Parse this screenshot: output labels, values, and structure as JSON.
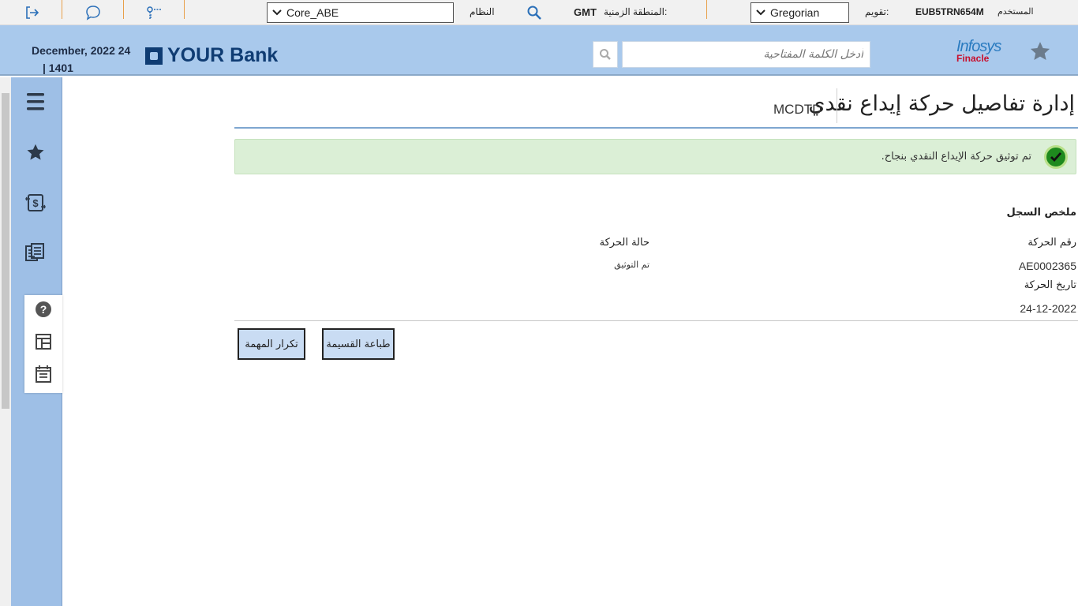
{
  "topbar": {
    "icons": [
      "logout-icon",
      "chat-icon",
      "key-icon"
    ],
    "environment_select": "Core_ABE",
    "system_label": "النظام",
    "timezone_label": "المنطقة الزمنية:",
    "timezone_value": "GMT",
    "calendar_select": "Gregorian",
    "calendar_label": "تقويم:",
    "user_label": "المستخدم",
    "user_id": "EUB5TRN654M"
  },
  "header": {
    "date_primary": "December, 2022 24",
    "date_secondary": "| 1401",
    "bank_name": "YOUR Bank",
    "search_placeholder": "أدخل الكلمة المفتاحية",
    "vendor_logo_line1": "Infosys",
    "vendor_logo_line2": "Finacle"
  },
  "sidebar": {
    "icons": [
      "menu-icon",
      "star-icon",
      "currency-exchange-icon",
      "documents-icon"
    ],
    "panel_icons": [
      "help-icon",
      "layout-icon",
      "calendar-icon"
    ]
  },
  "main": {
    "title": "إدارة تفاصيل حركة إيداع نقدي",
    "function_code": "MCDTD",
    "success_message": "تم توثيق حركة الإيداع النقدي بنجاح.",
    "summary_title": "ملخص السجل",
    "fields": {
      "transaction_id_label": "رقم الحركة",
      "transaction_id_value": "AE0002365",
      "transaction_date_label": "تاريخ الحركة",
      "transaction_date_value": "24-12-2022",
      "transaction_status_label": "حالة الحركة",
      "transaction_status_value": "تم التوثيق"
    },
    "buttons": {
      "print_receipt": "طباعة القسيمة",
      "repeat_task": "تكرار المهمة"
    }
  },
  "colors": {
    "header_bg": "#a9c9ec",
    "sidebar_bg": "#9ebfe6",
    "brand_navy": "#0f3c73",
    "success_bg": "#dbefd6",
    "button_bg": "#c9dcf3",
    "separator_orange": "#e8a04a"
  }
}
